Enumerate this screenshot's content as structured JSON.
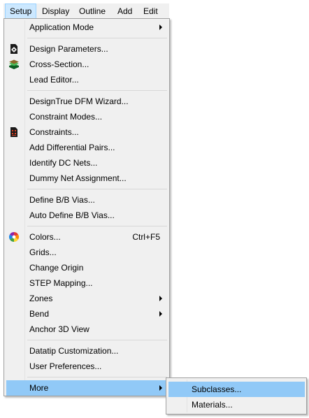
{
  "menubar": {
    "items": [
      {
        "label": "Setup"
      },
      {
        "label": "Display"
      },
      {
        "label": "Outline"
      },
      {
        "label": "Add"
      },
      {
        "label": "Edit"
      }
    ]
  },
  "menu": {
    "items": [
      {
        "label": "Application Mode",
        "has_submenu": true
      },
      {
        "label": "Design Parameters...",
        "icon": "design-parameters-icon"
      },
      {
        "label": "Cross-Section...",
        "icon": "cross-section-icon"
      },
      {
        "label": "Lead Editor..."
      },
      {
        "label": "DesignTrue DFM Wizard..."
      },
      {
        "label": "Constraint Modes..."
      },
      {
        "label": "Constraints...",
        "icon": "constraints-icon"
      },
      {
        "label": "Add Differential Pairs..."
      },
      {
        "label": "Identify DC Nets..."
      },
      {
        "label": "Dummy Net Assignment..."
      },
      {
        "label": "Define B/B Vias..."
      },
      {
        "label": "Auto Define B/B Vias..."
      },
      {
        "label": "Colors...",
        "shortcut": "Ctrl+F5",
        "icon": "colors-icon"
      },
      {
        "label": "Grids..."
      },
      {
        "label": "Change Origin"
      },
      {
        "label": "STEP Mapping..."
      },
      {
        "label": "Zones",
        "has_submenu": true
      },
      {
        "label": "Bend",
        "has_submenu": true
      },
      {
        "label": "Anchor 3D View"
      },
      {
        "label": "Datatip Customization..."
      },
      {
        "label": "User Preferences..."
      },
      {
        "label": "More",
        "has_submenu": true,
        "highlighted": true
      }
    ]
  },
  "submenu": {
    "items": [
      {
        "label": "Subclasses...",
        "highlighted": true
      },
      {
        "label": "Materials..."
      }
    ]
  },
  "colors": {
    "highlight": "#91c9f7",
    "menu_background": "#f0f0f0",
    "menubar_active": "#cce8ff"
  }
}
